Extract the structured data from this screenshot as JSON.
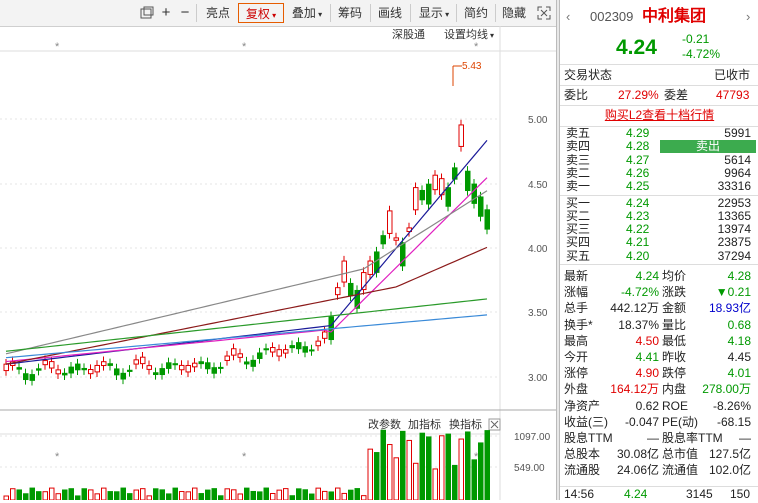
{
  "toolbar": {
    "items": [
      "亮点",
      "复权",
      "叠加",
      "筹码",
      "画线",
      "显示",
      "简约",
      "隐藏"
    ],
    "icons": [
      "restore-icon",
      "plus-icon",
      "minus-icon",
      "close-icon"
    ]
  },
  "chart": {
    "top_labels": {
      "shenzhen": "深股通",
      "ma_setting": "设置均线"
    },
    "max_marker": "5.43",
    "y_ticks": [
      "5.00",
      "4.50",
      "4.00",
      "3.50",
      "3.00"
    ],
    "volume_tabs": [
      "改参数",
      "加指标",
      "换指标"
    ],
    "volume_ticks": [
      "1097.00",
      "549.00"
    ]
  },
  "stock": {
    "code": "002309",
    "name": "中利集团",
    "price": "4.24",
    "change": "-0.21",
    "change_pct": "-4.72%"
  },
  "status": {
    "label": "交易状态",
    "value": "已收市"
  },
  "committee": {
    "ratio_label": "委比",
    "ratio": "27.29%",
    "diff_label": "委差",
    "diff": "47793"
  },
  "l2_link": "购买L2查看十档行情",
  "sell": [
    {
      "label": "卖五",
      "price": "4.29",
      "vol": "5991"
    },
    {
      "label": "卖四",
      "price": "4.28",
      "vol": "卖出"
    },
    {
      "label": "卖三",
      "price": "4.27",
      "vol": "5614"
    },
    {
      "label": "卖二",
      "price": "4.26",
      "vol": "9964"
    },
    {
      "label": "卖一",
      "price": "4.25",
      "vol": "33316"
    }
  ],
  "buy": [
    {
      "label": "买一",
      "price": "4.24",
      "vol": "22953"
    },
    {
      "label": "买二",
      "price": "4.23",
      "vol": "13365"
    },
    {
      "label": "买三",
      "price": "4.22",
      "vol": "13974"
    },
    {
      "label": "买四",
      "price": "4.21",
      "vol": "23875"
    },
    {
      "label": "买五",
      "price": "4.20",
      "vol": "37294"
    }
  ],
  "stats": [
    [
      {
        "l": "最新",
        "v": "4.24",
        "c": "g"
      },
      {
        "l": "均价",
        "v": "4.28",
        "c": "g"
      }
    ],
    [
      {
        "l": "涨幅",
        "v": "-4.72%",
        "c": "g"
      },
      {
        "l": "涨跌",
        "v": "▼0.21",
        "c": "g"
      }
    ],
    [
      {
        "l": "总手",
        "v": "442.12万",
        "c": "k"
      },
      {
        "l": "金额",
        "v": "18.93亿",
        "c": "b"
      }
    ],
    [
      {
        "l": "换手*",
        "v": "18.37%",
        "c": "k"
      },
      {
        "l": "量比",
        "v": "0.68",
        "c": "g"
      }
    ],
    [
      {
        "l": "最高",
        "v": "4.50",
        "c": "r"
      },
      {
        "l": "最低",
        "v": "4.18",
        "c": "g"
      }
    ],
    [
      {
        "l": "今开",
        "v": "4.41",
        "c": "g"
      },
      {
        "l": "昨收",
        "v": "4.45",
        "c": "k"
      }
    ],
    [
      {
        "l": "涨停",
        "v": "4.90",
        "c": "r"
      },
      {
        "l": "跌停",
        "v": "4.01",
        "c": "g"
      }
    ],
    [
      {
        "l": "外盘",
        "v": "164.12万",
        "c": "r"
      },
      {
        "l": "内盘",
        "v": "278.00万",
        "c": "g"
      }
    ],
    [
      {
        "l": "净资产",
        "v": "0.62",
        "c": "k"
      },
      {
        "l": "ROE",
        "v": "-8.26%",
        "c": "k"
      }
    ],
    [
      {
        "l": "收益(三)",
        "v": "-0.047",
        "c": "k"
      },
      {
        "l": "PE(动)",
        "v": "-68.15",
        "c": "k"
      }
    ],
    [
      {
        "l": "股息TTM",
        "v": "—",
        "c": "k"
      },
      {
        "l": "股息率TTM",
        "v": "—",
        "c": "k"
      }
    ],
    [
      {
        "l": "总股本",
        "v": "30.08亿",
        "c": "k"
      },
      {
        "l": "总市值",
        "v": "127.5亿",
        "c": "k"
      }
    ],
    [
      {
        "l": "流通股",
        "v": "24.06亿",
        "c": "k"
      },
      {
        "l": "流通值",
        "v": "102.0亿",
        "c": "k"
      }
    ]
  ],
  "tick": {
    "time": "14:56",
    "price": "4.24",
    "vol": "3145",
    "num": "150"
  }
}
